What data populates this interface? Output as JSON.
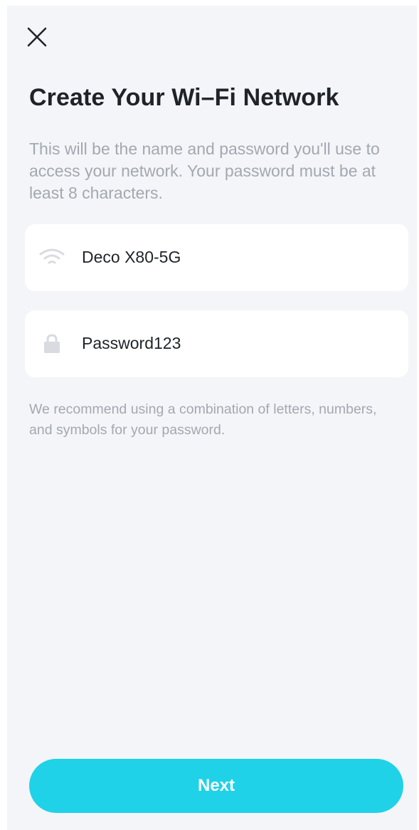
{
  "header": {
    "close_icon": "close-icon"
  },
  "page": {
    "title": "Create Your Wi–Fi Network",
    "description": "This will be the name and password you'll use to access your network. Your password must be at least 8 characters."
  },
  "form": {
    "ssid": {
      "icon": "wifi-icon",
      "value": "Deco X80-5G"
    },
    "password": {
      "icon": "lock-icon",
      "value": "Password123"
    },
    "hint": "We recommend using a combination of letters, numbers, and symbols for your password."
  },
  "actions": {
    "next_label": "Next"
  },
  "colors": {
    "background": "#f4f5f9",
    "field_background": "#ffffff",
    "title": "#1f2329",
    "muted_text": "#a3a8b0",
    "icon": "#d9dbe0",
    "accent": "#1fd2e8",
    "button_text": "#ffffff"
  }
}
